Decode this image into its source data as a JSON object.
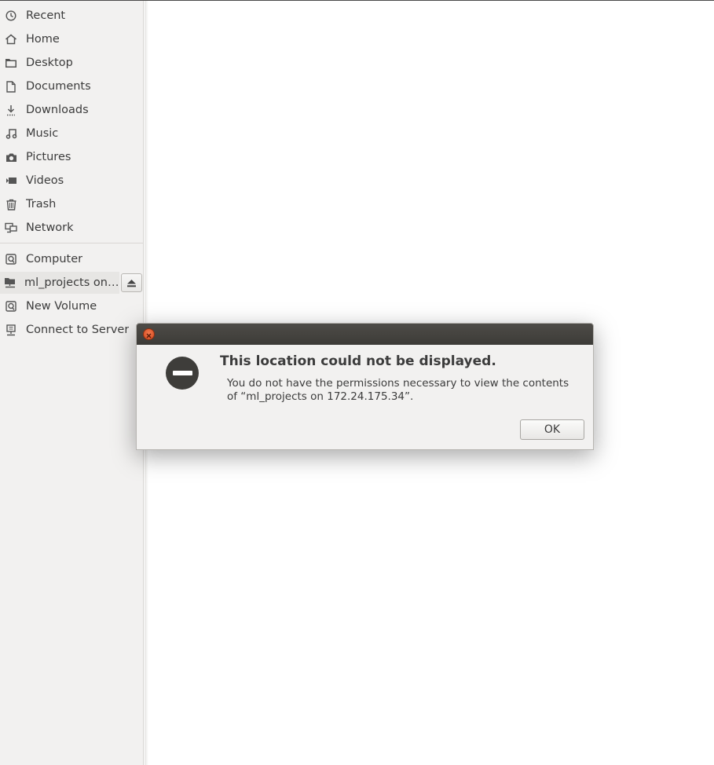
{
  "sidebar": {
    "places": [
      {
        "label": "Recent",
        "icon": "clock-icon"
      },
      {
        "label": "Home",
        "icon": "home-icon"
      },
      {
        "label": "Desktop",
        "icon": "folder-icon"
      },
      {
        "label": "Documents",
        "icon": "document-icon"
      },
      {
        "label": "Downloads",
        "icon": "download-icon"
      },
      {
        "label": "Music",
        "icon": "music-icon"
      },
      {
        "label": "Pictures",
        "icon": "camera-icon"
      },
      {
        "label": "Videos",
        "icon": "video-icon"
      },
      {
        "label": "Trash",
        "icon": "trash-icon"
      },
      {
        "label": "Network",
        "icon": "network-icon"
      }
    ],
    "devices": [
      {
        "label": "Computer",
        "icon": "drive-icon"
      },
      {
        "label": "ml_projects on 172.24.175.34",
        "icon": "network-share-icon",
        "active": true
      },
      {
        "label": "New Volume",
        "icon": "drive-icon"
      },
      {
        "label": "Connect to Server",
        "icon": "server-icon"
      }
    ]
  },
  "dialog": {
    "title": "This location could not be displayed.",
    "message": "You do not have the permissions necessary to view the contents of “ml_projects on 172.24.175.34”.",
    "ok_label": "OK"
  },
  "colors": {
    "sidebar_bg": "#f2f1f0",
    "titlebar_bg": "#3c3b37",
    "close_button": "#e05a2b",
    "text": "#3c3c3c"
  }
}
